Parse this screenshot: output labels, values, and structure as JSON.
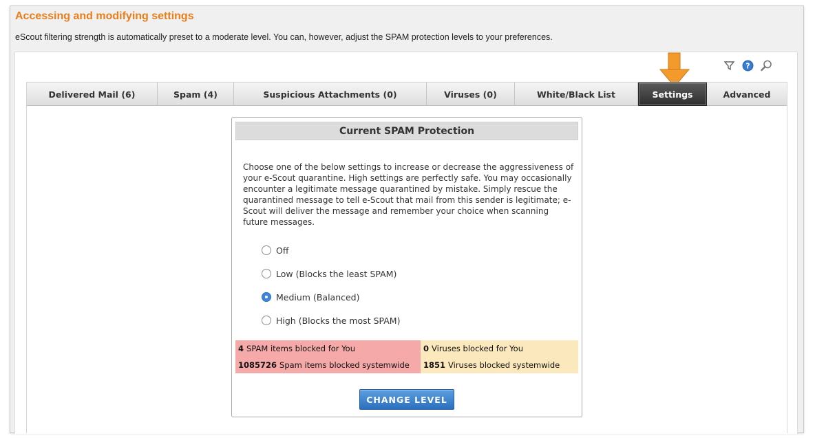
{
  "header": {
    "title": "Accessing and modifying settings",
    "description": "eScout filtering strength is automatically preset to a moderate level. You can, however, adjust the SPAM protection levels to your preferences."
  },
  "colors": {
    "accent": "#e87e1c",
    "arrow": "#f39a2c",
    "spam_bg": "#f5a9a9",
    "virus_bg": "#fbe9bd",
    "button": "#3d86dc"
  },
  "toolbar": {
    "icons": [
      "filter-icon",
      "help-icon",
      "search-icon"
    ]
  },
  "tabs": [
    {
      "label": "Delivered Mail (6)",
      "active": false
    },
    {
      "label": "Spam (4)",
      "active": false
    },
    {
      "label": "Suspicious Attachments (0)",
      "active": false
    },
    {
      "label": "Viruses (0)",
      "active": false
    },
    {
      "label": "White/Black List",
      "active": false
    },
    {
      "label": "Settings",
      "active": true
    },
    {
      "label": "Advanced",
      "active": false
    }
  ],
  "panel": {
    "title": "Current SPAM Protection",
    "description": "Choose one of the below settings to increase or decrease the aggressiveness of your e-Scout quarantine. High settings are perfectly safe. You may occasionally encounter a legitimate message quarantined by mistake. Simply rescue the quarantined message to tell e-Scout that mail from this sender is legitimate; e-Scout will deliver the message and remember your choice when scanning future messages.",
    "options": [
      {
        "label": "Off",
        "selected": false
      },
      {
        "label": "Low (Blocks the least SPAM)",
        "selected": false
      },
      {
        "label": "Medium (Balanced)",
        "selected": true
      },
      {
        "label": "High (Blocks the most SPAM)",
        "selected": false
      }
    ],
    "stats": {
      "spam_user": {
        "count": "4",
        "label": "SPAM items blocked for You"
      },
      "virus_user": {
        "count": "0",
        "label": "Viruses blocked for You"
      },
      "spam_system": {
        "count": "1085726",
        "label": "Spam items blocked systemwide"
      },
      "virus_system": {
        "count": "1851",
        "label": "Viruses blocked systemwide"
      }
    },
    "button_label": "CHANGE LEVEL"
  }
}
